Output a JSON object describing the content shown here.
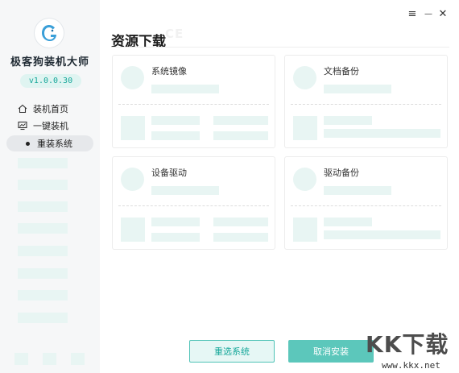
{
  "app": {
    "title": "极客狗装机大师",
    "version": "v1.0.0.30"
  },
  "window_controls": {
    "menu": "≡",
    "minimize": "—",
    "close": "✕"
  },
  "nav": {
    "items": [
      {
        "label": "装机首页",
        "icon": "home-icon"
      },
      {
        "label": "一键装机",
        "icon": "monitor-icon"
      },
      {
        "label": "重装系统",
        "icon": "dot-icon",
        "active": true
      }
    ]
  },
  "main": {
    "title": "资源下载",
    "ghost_text": "CE",
    "cards": [
      {
        "label": "系统镜像"
      },
      {
        "label": "文档备份"
      },
      {
        "label": "设备驱动"
      },
      {
        "label": "驱动备份"
      }
    ]
  },
  "actions": {
    "reselect": "重选系统",
    "cancel": "取消安装"
  },
  "watermark": {
    "main": "KK下载",
    "sub": "www.kkx.net"
  },
  "colors": {
    "accent": "#5cc7bb",
    "accent_text": "#16a79a",
    "skeleton": "#e8f5f3"
  }
}
